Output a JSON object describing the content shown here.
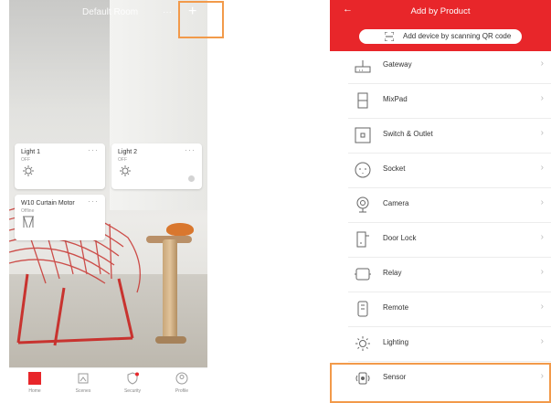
{
  "left": {
    "room_title": "Default Room",
    "header_extra": "···",
    "add_symbol": "+",
    "cards": [
      {
        "name": "Light 1",
        "status": "OFF",
        "more": "···"
      },
      {
        "name": "Light 2",
        "status": "OFF",
        "more": "···"
      },
      {
        "name": "W10 Curtain Motor",
        "status": "Offline",
        "more": "···"
      }
    ],
    "nav": [
      {
        "label": "Home",
        "icon": "home-icon"
      },
      {
        "label": "Scenes",
        "icon": "scenes-icon"
      },
      {
        "label": "Security",
        "icon": "security-icon"
      },
      {
        "label": "Profile",
        "icon": "profile-icon"
      }
    ]
  },
  "right": {
    "title": "Add by Product",
    "back_symbol": "←",
    "scan_label": "Add device by scanning QR code",
    "products": [
      {
        "label": "Gateway",
        "icon": "gateway-icon"
      },
      {
        "label": "MixPad",
        "icon": "mixpad-icon"
      },
      {
        "label": "Switch & Outlet",
        "icon": "switch-icon"
      },
      {
        "label": "Socket",
        "icon": "socket-icon"
      },
      {
        "label": "Camera",
        "icon": "camera-icon"
      },
      {
        "label": "Door Lock",
        "icon": "door-lock-icon"
      },
      {
        "label": "Relay",
        "icon": "relay-icon"
      },
      {
        "label": "Remote",
        "icon": "remote-icon"
      },
      {
        "label": "Lighting",
        "icon": "lighting-icon"
      },
      {
        "label": "Sensor",
        "icon": "sensor-icon"
      }
    ],
    "chevron": "›"
  },
  "colors": {
    "brand_red": "#e8262a",
    "highlight_orange": "#f29a4a"
  }
}
